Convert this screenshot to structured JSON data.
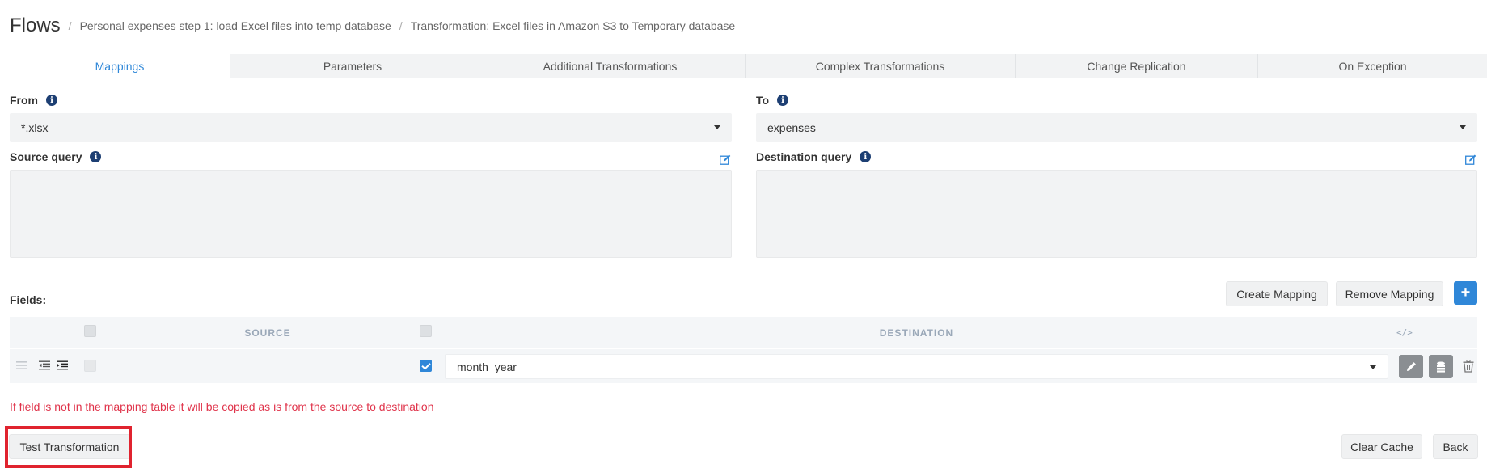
{
  "header": {
    "title": "Flows",
    "breadcrumbs": [
      "Personal expenses step 1: load Excel files into temp database",
      "Transformation: Excel files in Amazon S3 to Temporary database"
    ],
    "separator": "/"
  },
  "tabs": [
    {
      "label": "Mappings",
      "active": true
    },
    {
      "label": "Parameters",
      "active": false
    },
    {
      "label": "Additional Transformations",
      "active": false
    },
    {
      "label": "Complex Transformations",
      "active": false
    },
    {
      "label": "Change Replication",
      "active": false
    },
    {
      "label": "On Exception",
      "active": false
    }
  ],
  "from": {
    "label": "From",
    "value": "*.xlsx"
  },
  "to": {
    "label": "To",
    "value": "expenses"
  },
  "source_query": {
    "label": "Source query",
    "value": ""
  },
  "destination_query": {
    "label": "Destination query",
    "value": ""
  },
  "fields": {
    "label": "Fields:",
    "buttons": {
      "create": "Create Mapping",
      "remove": "Remove Mapping",
      "add": "+"
    },
    "columns": {
      "source": "SOURCE",
      "destination": "DESTINATION",
      "code": "</>"
    },
    "rows": [
      {
        "source": "",
        "source_checked": false,
        "destination": "month_year",
        "destination_checked": true
      }
    ]
  },
  "warning": "If field is not in the mapping table it will be copied as is from the source to destination",
  "footer": {
    "test": "Test Transformation",
    "clear_cache": "Clear Cache",
    "back": "Back"
  },
  "colors": {
    "accent": "#2f87d8",
    "warning": "#e0344b",
    "highlight": "#e0232f"
  }
}
